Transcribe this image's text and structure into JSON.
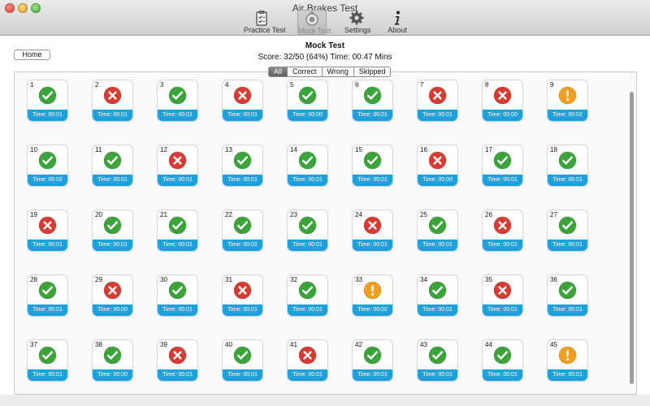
{
  "window": {
    "title": "Air Brakes Test"
  },
  "toolbar": {
    "items": [
      {
        "label": "Practice Test",
        "icon": "clipboard-icon"
      },
      {
        "label": "Mock Test",
        "icon": "timer-icon",
        "active": true
      },
      {
        "label": "Settings",
        "icon": "gear-icon"
      },
      {
        "label": "About",
        "icon": "info-icon"
      }
    ]
  },
  "header": {
    "home_label": "Home",
    "title": "Mock Test",
    "score_line": "Score: 32/50 (64%) Time: 00:47 Mins"
  },
  "filters": {
    "selected": "All",
    "options": [
      "All",
      "Correct",
      "Wrong",
      "Skipped"
    ]
  },
  "colors": {
    "accent": "#1ea0dc",
    "correct": "#3aa33a",
    "wrong": "#d93a32",
    "skipped": "#f0a020"
  },
  "questions": [
    {
      "num": "1",
      "status": "correct",
      "time": "Time: 00:01"
    },
    {
      "num": "2",
      "status": "wrong",
      "time": "Time: 00:01"
    },
    {
      "num": "3",
      "status": "correct",
      "time": "Time: 00:01"
    },
    {
      "num": "4",
      "status": "wrong",
      "time": "Time: 00:01"
    },
    {
      "num": "5",
      "status": "correct",
      "time": "Time: 00:00"
    },
    {
      "num": "6",
      "status": "correct",
      "time": "Time: 00:01"
    },
    {
      "num": "7",
      "status": "wrong",
      "time": "Time: 00:01"
    },
    {
      "num": "8",
      "status": "wrong",
      "time": "Time: 00:00"
    },
    {
      "num": "9",
      "status": "skipped",
      "time": "Time: 00:02"
    },
    {
      "num": "10",
      "status": "correct",
      "time": "Time: 00:02"
    },
    {
      "num": "11",
      "status": "correct",
      "time": "Time: 00:01"
    },
    {
      "num": "12",
      "status": "wrong",
      "time": "Time: 00:01"
    },
    {
      "num": "13",
      "status": "correct",
      "time": "Time: 00:01"
    },
    {
      "num": "14",
      "status": "correct",
      "time": "Time: 00:01"
    },
    {
      "num": "15",
      "status": "correct",
      "time": "Time: 00:01"
    },
    {
      "num": "16",
      "status": "wrong",
      "time": "Time: 00:00"
    },
    {
      "num": "17",
      "status": "correct",
      "time": "Time: 00:01"
    },
    {
      "num": "18",
      "status": "correct",
      "time": "Time: 00:01"
    },
    {
      "num": "19",
      "status": "wrong",
      "time": "Time: 00:01"
    },
    {
      "num": "20",
      "status": "correct",
      "time": "Time: 00:01"
    },
    {
      "num": "21",
      "status": "correct",
      "time": "Time: 00:01"
    },
    {
      "num": "22",
      "status": "correct",
      "time": "Time: 00:02"
    },
    {
      "num": "23",
      "status": "correct",
      "time": "Time: 00:01"
    },
    {
      "num": "24",
      "status": "wrong",
      "time": "Time: 00:01"
    },
    {
      "num": "25",
      "status": "correct",
      "time": "Time: 00:01"
    },
    {
      "num": "26",
      "status": "wrong",
      "time": "Time: 00:01"
    },
    {
      "num": "27",
      "status": "correct",
      "time": "Time: 00:01"
    },
    {
      "num": "28",
      "status": "correct",
      "time": "Time: 00:01"
    },
    {
      "num": "29",
      "status": "wrong",
      "time": "Time: 00:00"
    },
    {
      "num": "30",
      "status": "correct",
      "time": "Time: 00:01"
    },
    {
      "num": "31",
      "status": "wrong",
      "time": "Time: 00:01"
    },
    {
      "num": "32",
      "status": "correct",
      "time": "Time: 00:01"
    },
    {
      "num": "33",
      "status": "skipped",
      "time": "Time: 00:02"
    },
    {
      "num": "34",
      "status": "correct",
      "time": "Time: 00:01"
    },
    {
      "num": "35",
      "status": "wrong",
      "time": "Time: 00:01"
    },
    {
      "num": "36",
      "status": "correct",
      "time": "Time: 00:01"
    },
    {
      "num": "37",
      "status": "correct",
      "time": "Time: 00:01"
    },
    {
      "num": "38",
      "status": "correct",
      "time": "Time: 00:00"
    },
    {
      "num": "39",
      "status": "wrong",
      "time": "Time: 00:01"
    },
    {
      "num": "40",
      "status": "correct",
      "time": "Time: 00:01"
    },
    {
      "num": "41",
      "status": "wrong",
      "time": "Time: 00:01"
    },
    {
      "num": "42",
      "status": "correct",
      "time": "Time: 00:01"
    },
    {
      "num": "43",
      "status": "correct",
      "time": "Time: 00:01"
    },
    {
      "num": "44",
      "status": "correct",
      "time": "Time: 00:01"
    },
    {
      "num": "45",
      "status": "skipped",
      "time": "Time: 00:01"
    }
  ]
}
